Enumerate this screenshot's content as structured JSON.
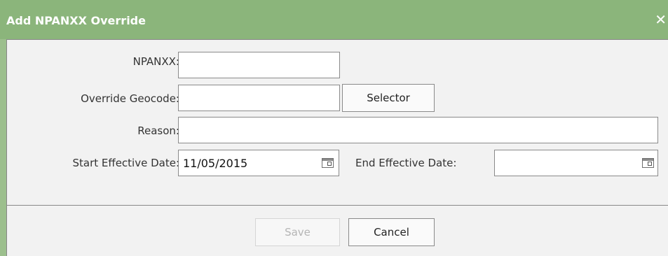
{
  "dialog": {
    "title": "Add NPANXX Override",
    "close_glyph": "✕"
  },
  "form": {
    "npanxx_label": "NPANXX:",
    "npanxx_value": "",
    "geocode_label": "Override Geocode:",
    "geocode_value": "",
    "selector_label": "Selector",
    "reason_label": "Reason:",
    "reason_value": "",
    "start_label": "Start Effective Date:",
    "start_value": "11/05/2015",
    "end_label": "End Effective Date:",
    "end_value": ""
  },
  "buttons": {
    "save_label": "Save",
    "cancel_label": "Cancel"
  },
  "icons": {
    "calendar": "calendar-icon",
    "close": "close-icon"
  },
  "colors": {
    "titlebar": "#8bb57b",
    "panel": "#f2f2f2"
  }
}
